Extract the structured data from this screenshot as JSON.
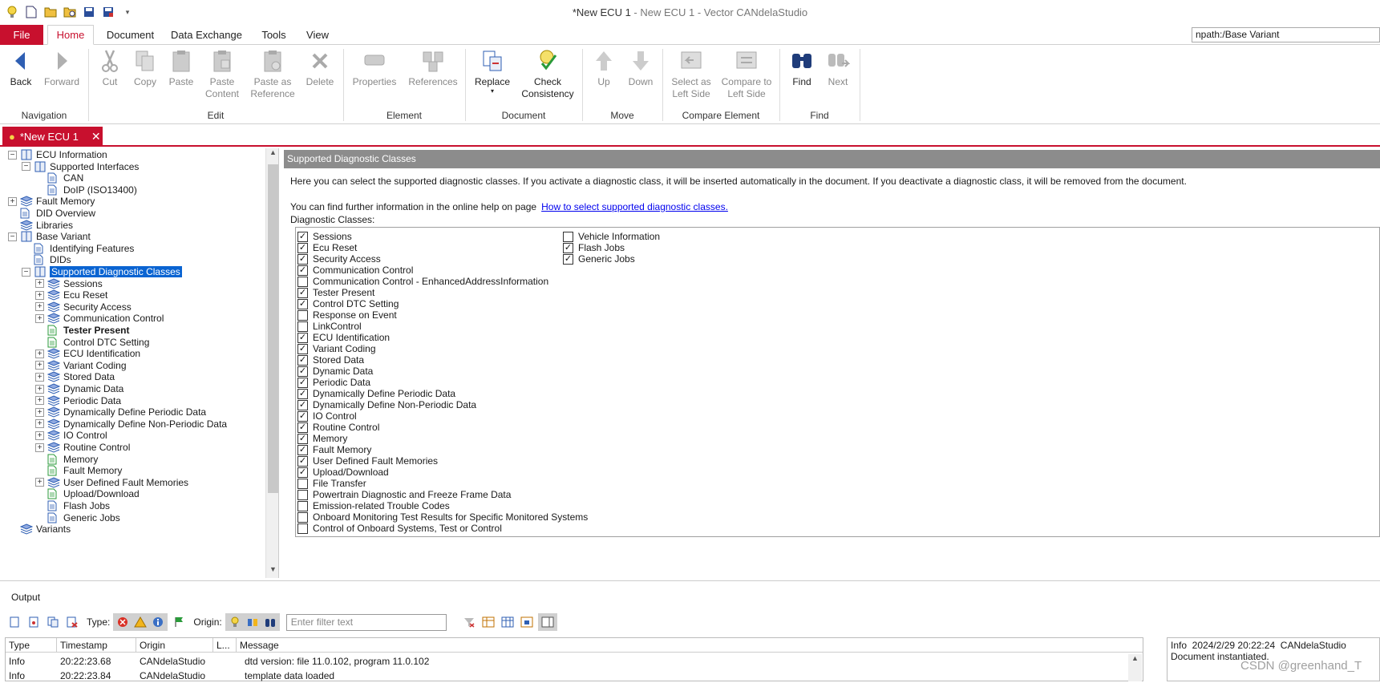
{
  "window": {
    "title_main": "*New ECU 1",
    "title_sub": " - New ECU 1 - Vector CANdelaStudio"
  },
  "ribbon_tabs": [
    "File",
    "Home",
    "Document",
    "Data Exchange",
    "Tools",
    "View"
  ],
  "npath": "npath:/Base Variant",
  "ribbon": {
    "buttons": {
      "back": "Back",
      "forward": "Forward",
      "cut": "Cut",
      "copy": "Copy",
      "paste": "Paste",
      "paste_content": "Paste\nContent",
      "paste_ref": "Paste as\nReference",
      "delete": "Delete",
      "properties": "Properties",
      "references": "References",
      "replace": "Replace",
      "check": "Check\nConsistency",
      "up": "Up",
      "down": "Down",
      "select_left": "Select as\nLeft Side",
      "compare_left": "Compare to\nLeft Side",
      "find": "Find",
      "next": "Next"
    },
    "groups": {
      "navigation": "Navigation",
      "edit": "Edit",
      "element": "Element",
      "document": "Document",
      "move": "Move",
      "compare": "Compare Element",
      "find": "Find"
    }
  },
  "doc_tab": {
    "label": "*New ECU 1",
    "close": "✕"
  },
  "tree": {
    "items": [
      {
        "label": "ECU Information",
        "indent": 0,
        "exp": "minus",
        "icon": "book"
      },
      {
        "label": "Supported Interfaces",
        "indent": 1,
        "exp": "minus",
        "icon": "book"
      },
      {
        "label": "CAN",
        "indent": 2,
        "exp": "none",
        "icon": "page"
      },
      {
        "label": "DoIP (ISO13400)",
        "indent": 2,
        "exp": "none",
        "icon": "page"
      },
      {
        "label": "Fault Memory",
        "indent": 0,
        "exp": "plus",
        "icon": "stack"
      },
      {
        "label": "DID Overview",
        "indent": 0,
        "exp": "none",
        "icon": "page"
      },
      {
        "label": "Libraries",
        "indent": 0,
        "exp": "none",
        "icon": "stack"
      },
      {
        "label": "Base Variant",
        "indent": 0,
        "exp": "minus",
        "icon": "book"
      },
      {
        "label": "Identifying Features",
        "indent": 1,
        "exp": "none",
        "icon": "page"
      },
      {
        "label": "DIDs",
        "indent": 1,
        "exp": "none",
        "icon": "page"
      },
      {
        "label": "Supported Diagnostic Classes",
        "indent": 1,
        "exp": "minus",
        "icon": "book",
        "selected": true
      },
      {
        "label": "Sessions",
        "indent": 2,
        "exp": "plus",
        "icon": "stack"
      },
      {
        "label": "Ecu Reset",
        "indent": 2,
        "exp": "plus",
        "icon": "stack"
      },
      {
        "label": "Security Access",
        "indent": 2,
        "exp": "plus",
        "icon": "stack"
      },
      {
        "label": "Communication Control",
        "indent": 2,
        "exp": "plus",
        "icon": "stack"
      },
      {
        "label": "Tester Present",
        "indent": 2,
        "exp": "none",
        "icon": "greenpage",
        "bold": true
      },
      {
        "label": "Control DTC Setting",
        "indent": 2,
        "exp": "none",
        "icon": "greenpage"
      },
      {
        "label": "ECU Identification",
        "indent": 2,
        "exp": "plus",
        "icon": "stack"
      },
      {
        "label": "Variant Coding",
        "indent": 2,
        "exp": "plus",
        "icon": "stack"
      },
      {
        "label": "Stored Data",
        "indent": 2,
        "exp": "plus",
        "icon": "stack"
      },
      {
        "label": "Dynamic Data",
        "indent": 2,
        "exp": "plus",
        "icon": "stack"
      },
      {
        "label": "Periodic Data",
        "indent": 2,
        "exp": "plus",
        "icon": "stack"
      },
      {
        "label": "Dynamically Define Periodic Data",
        "indent": 2,
        "exp": "plus",
        "icon": "stack"
      },
      {
        "label": "Dynamically Define Non-Periodic Data",
        "indent": 2,
        "exp": "plus",
        "icon": "stack"
      },
      {
        "label": "IO Control",
        "indent": 2,
        "exp": "plus",
        "icon": "stack"
      },
      {
        "label": "Routine Control",
        "indent": 2,
        "exp": "plus",
        "icon": "stack"
      },
      {
        "label": "Memory",
        "indent": 2,
        "exp": "none",
        "icon": "greenpage"
      },
      {
        "label": "Fault Memory",
        "indent": 2,
        "exp": "none",
        "icon": "greenpage"
      },
      {
        "label": "User Defined Fault Memories",
        "indent": 2,
        "exp": "plus",
        "icon": "stack"
      },
      {
        "label": "Upload/Download",
        "indent": 2,
        "exp": "none",
        "icon": "greenpage"
      },
      {
        "label": "Flash Jobs",
        "indent": 2,
        "exp": "none",
        "icon": "page"
      },
      {
        "label": "Generic Jobs",
        "indent": 2,
        "exp": "none",
        "icon": "page"
      },
      {
        "label": "Variants",
        "indent": 0,
        "exp": "none",
        "icon": "stack"
      }
    ]
  },
  "main": {
    "header": "Supported Diagnostic Classes",
    "intro": "Here you can select the supported diagnostic classes. If you activate a diagnostic class, it will be inserted automatically in the document. If you deactivate a diagnostic class, it will be removed from the document.",
    "help_prefix": "You can find further information in the online help on page",
    "help_link": "How to select supported diagnostic classes.",
    "classes_label": "Diagnostic Classes:",
    "col1": [
      {
        "label": "Sessions",
        "checked": true
      },
      {
        "label": "Ecu Reset",
        "checked": true
      },
      {
        "label": "Security Access",
        "checked": true
      },
      {
        "label": "Communication Control",
        "checked": true
      },
      {
        "label": "Communication Control - EnhancedAddressInformation",
        "checked": false
      },
      {
        "label": "Tester Present",
        "checked": true
      },
      {
        "label": "Control DTC Setting",
        "checked": true
      },
      {
        "label": "Response on Event",
        "checked": false
      },
      {
        "label": "LinkControl",
        "checked": false
      },
      {
        "label": "ECU Identification",
        "checked": true
      },
      {
        "label": "Variant Coding",
        "checked": true
      },
      {
        "label": "Stored Data",
        "checked": true
      },
      {
        "label": "Dynamic Data",
        "checked": true
      },
      {
        "label": "Periodic Data",
        "checked": true
      },
      {
        "label": "Dynamically Define Periodic Data",
        "checked": true
      },
      {
        "label": "Dynamically Define Non-Periodic Data",
        "checked": true
      },
      {
        "label": "IO Control",
        "checked": true
      },
      {
        "label": "Routine Control",
        "checked": true
      },
      {
        "label": "Memory",
        "checked": true
      },
      {
        "label": "Fault Memory",
        "checked": true
      },
      {
        "label": "User Defined Fault Memories",
        "checked": true
      },
      {
        "label": "Upload/Download",
        "checked": true
      },
      {
        "label": "File Transfer",
        "checked": false
      },
      {
        "label": "Powertrain Diagnostic and Freeze Frame Data",
        "checked": false
      },
      {
        "label": "Emission-related Trouble Codes",
        "checked": false
      },
      {
        "label": "Onboard Monitoring Test Results for Specific Monitored Systems",
        "checked": false
      },
      {
        "label": "Control of Onboard Systems, Test or Control",
        "checked": false
      }
    ],
    "col2": [
      {
        "label": "Vehicle Information",
        "checked": false
      },
      {
        "label": "Flash Jobs",
        "checked": true
      },
      {
        "label": "Generic Jobs",
        "checked": true
      }
    ]
  },
  "output": {
    "title": "Output",
    "type_label": "Type:",
    "origin_label": "Origin:",
    "filter_placeholder": "Enter filter text",
    "columns": [
      "Type",
      "Timestamp",
      "Origin",
      "L...",
      "Message"
    ],
    "rows": [
      [
        "Info",
        "20:22:23.68",
        "CANdelaStudio",
        "",
        "dtd version: file 11.0.102, program 11.0.102"
      ],
      [
        "Info",
        "20:22:23.84",
        "CANdelaStudio",
        "",
        "template data loaded"
      ]
    ],
    "detail_line1": "Info  2024/2/29 20:22:24  CANdelaStudio",
    "detail_line2": "Document instantiated."
  },
  "watermark": "CSDN @greenhand_T",
  "colors": {
    "accent": "#c8102e",
    "selection": "#0a64d2",
    "header_gray": "#8c8c8c"
  }
}
